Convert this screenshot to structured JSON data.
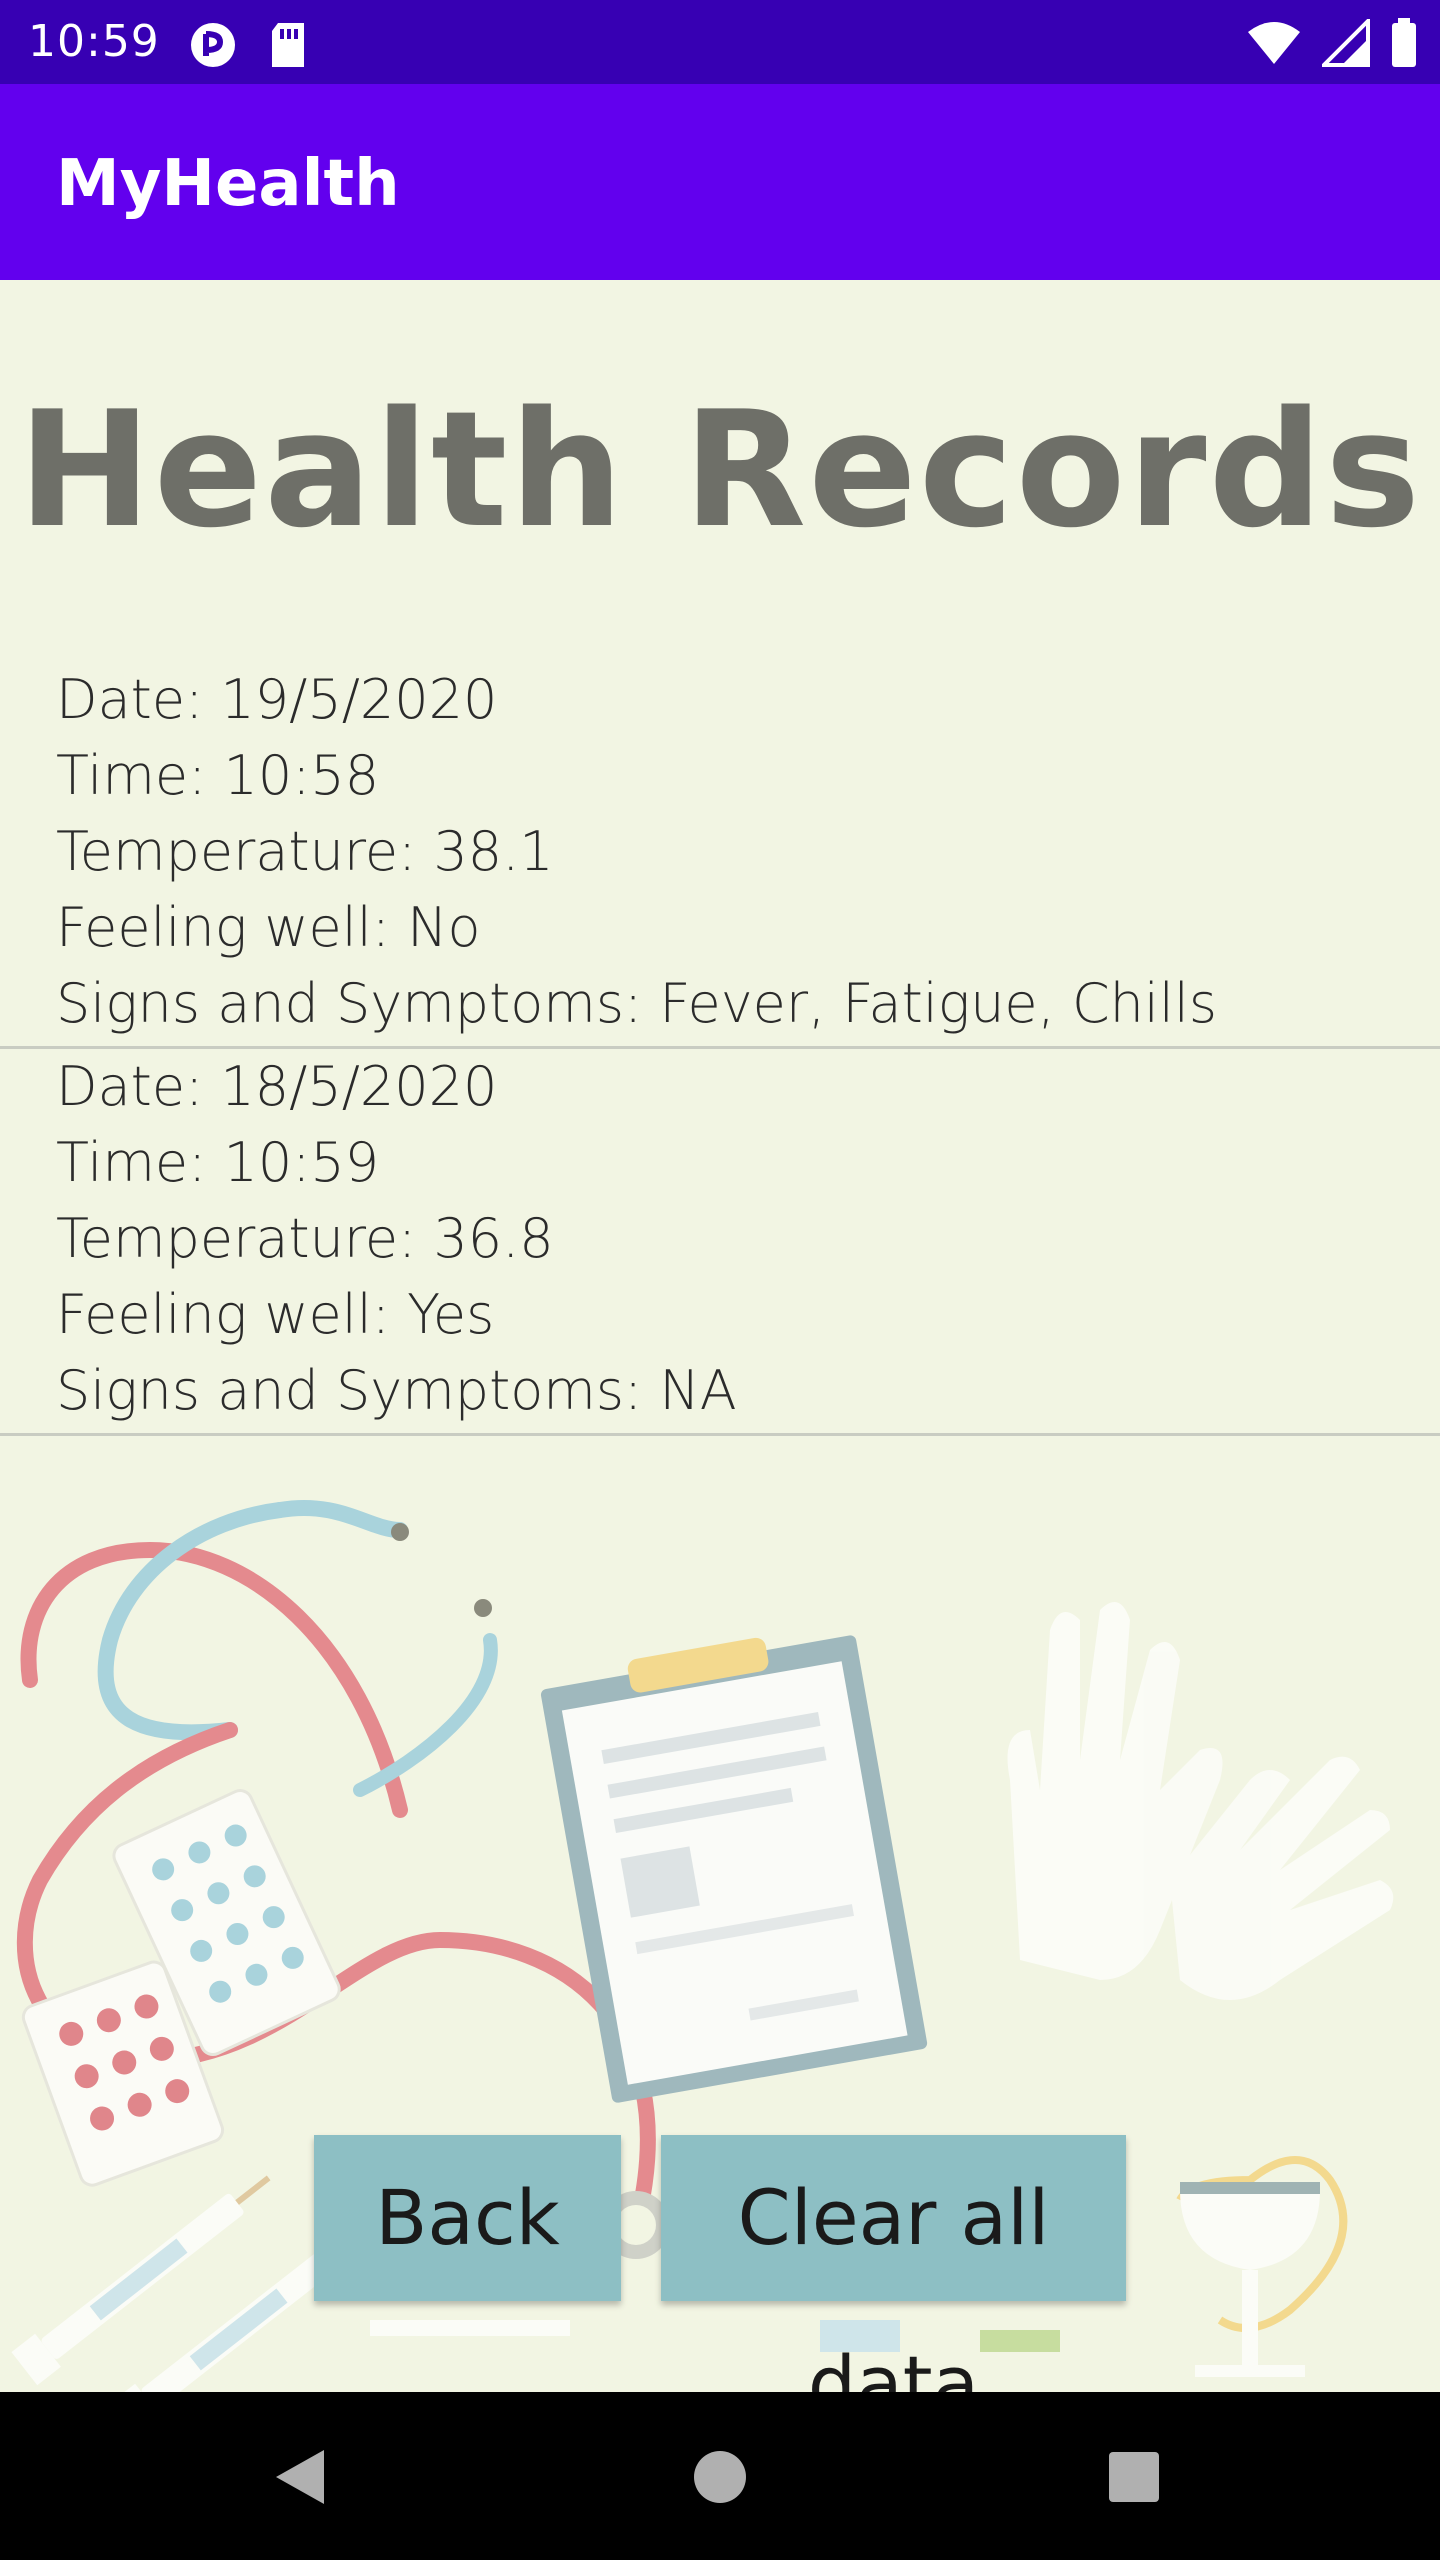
{
  "status_bar": {
    "time": "10:59",
    "icons": [
      "data-saver-icon",
      "sd-card-icon",
      "wifi-icon",
      "signal-icon",
      "battery-icon"
    ]
  },
  "app_bar": {
    "title": "MyHealth"
  },
  "page": {
    "title": "Health Records"
  },
  "records": [
    {
      "date": "Date: 19/5/2020",
      "time": "Time: 10:58",
      "temperature": "Temperature: 38.1",
      "feeling_well": "Feeling well: No",
      "symptoms": "Signs and Symptoms: Fever, Fatigue, Chills"
    },
    {
      "date": "Date: 18/5/2020",
      "time": "Time: 10:59",
      "temperature": "Temperature: 36.8",
      "feeling_well": "Feeling well: Yes",
      "symptoms": "Signs and Symptoms: NA"
    }
  ],
  "buttons": {
    "back_label": "Back",
    "clear_label": "Clear all data"
  },
  "nav": {
    "icons": [
      "back-triangle-icon",
      "home-circle-icon",
      "recents-square-icon"
    ]
  },
  "colors": {
    "status_bar": "#3700b3",
    "app_bar": "#6200ee",
    "background": "#f2f5e3",
    "button": "#8dbfc4",
    "title_text": "#6e6f68"
  }
}
